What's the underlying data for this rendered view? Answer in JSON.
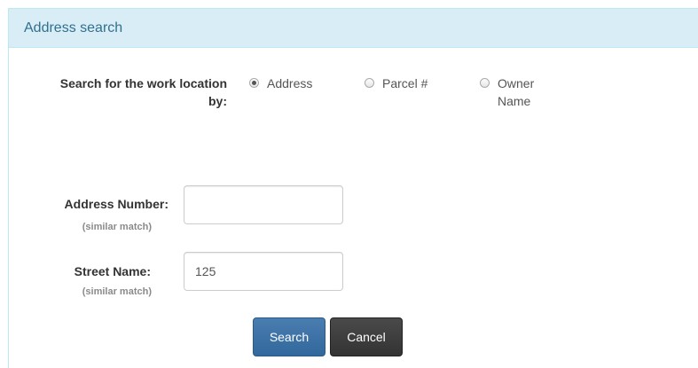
{
  "panel": {
    "title": "Address search"
  },
  "search_by": {
    "label_line1": "Search for the work location",
    "label_line2": "by:",
    "options": [
      {
        "label": "Address",
        "checked": true
      },
      {
        "label": "Parcel #",
        "checked": false
      },
      {
        "label_line1": "Owner",
        "label_line2": "Name",
        "checked": false
      }
    ]
  },
  "address_number": {
    "label": "Address Number:",
    "hint": "(similar match)",
    "value": ""
  },
  "street_name": {
    "label": "Street Name:",
    "hint": "(similar match)",
    "value": "125"
  },
  "buttons": {
    "search_label": "Search",
    "cancel_label": "Cancel"
  },
  "colors": {
    "heading_bg": "#d9edf7",
    "heading_text": "#31708f",
    "search_button": "#3a6fa3",
    "cancel_button": "#3d3d3d"
  }
}
